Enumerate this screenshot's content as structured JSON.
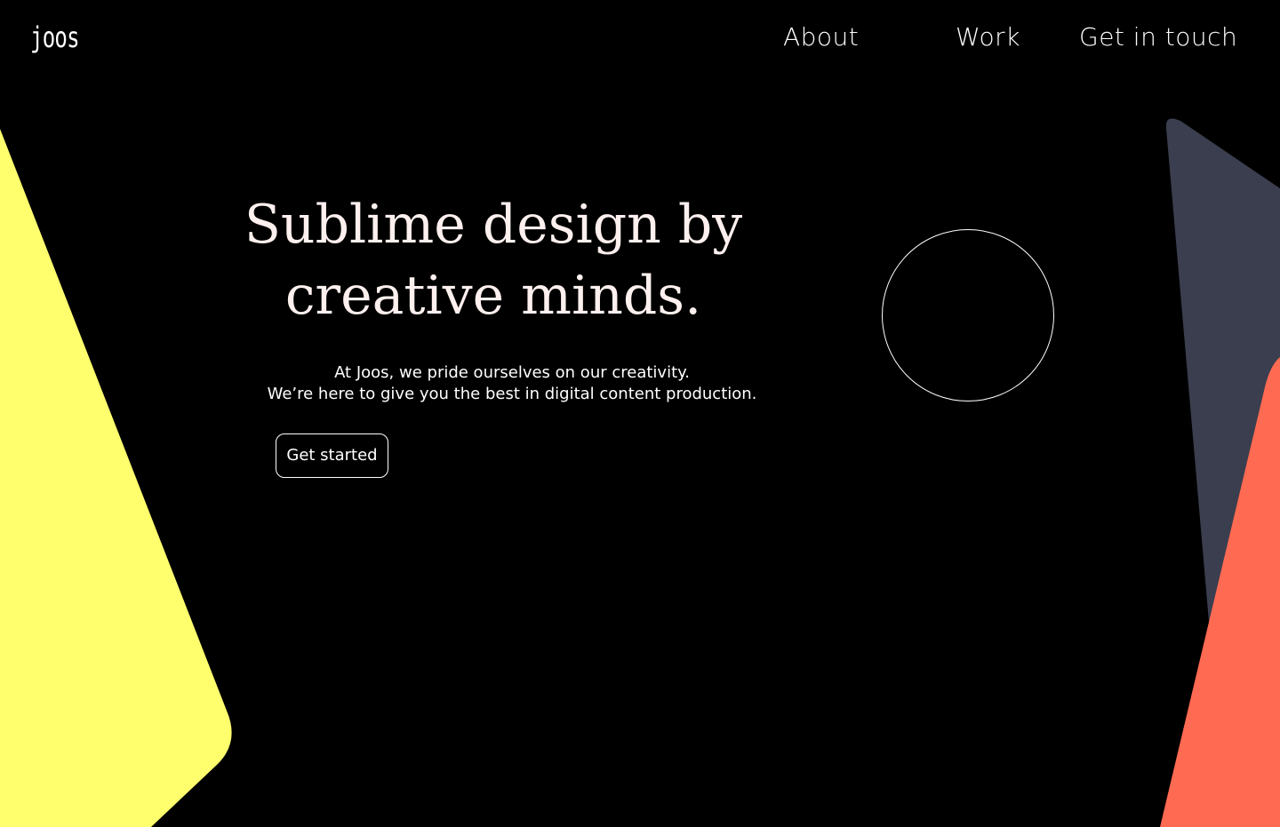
{
  "brand": {
    "logo_text": "joos"
  },
  "nav": {
    "items": [
      {
        "label": "About"
      },
      {
        "label": "Work"
      },
      {
        "label": "Get in touch"
      }
    ]
  },
  "hero": {
    "title_line1": "Sublime design by",
    "title_line2": "creative minds.",
    "subtitle_line1": "At Joos, we pride ourselves on our creativity.",
    "subtitle_line2": "We’re here to give you the best in digital content production.",
    "cta_label": "Get started"
  },
  "colors": {
    "background": "#000000",
    "yellow": "#FFFF6E",
    "slate": "#3A3E4E",
    "coral": "#FF6A52",
    "text": "#FFFFFF",
    "title": "#FDF0EE"
  }
}
